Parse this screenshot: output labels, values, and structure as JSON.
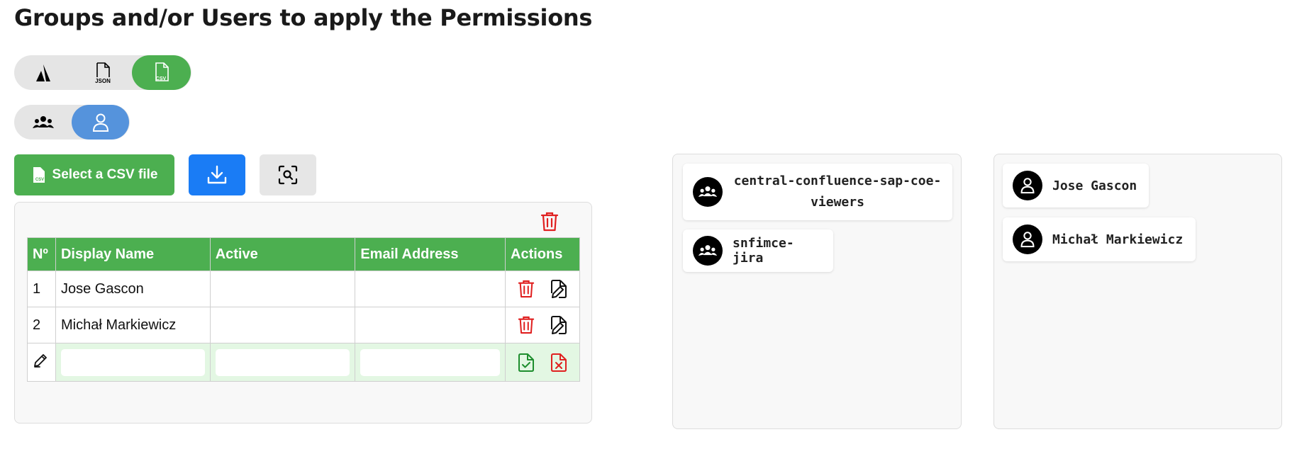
{
  "page_title": "Groups and/or Users to apply the Permissions",
  "source_toggle": {
    "options": [
      {
        "icon": "atlassian-icon",
        "label": ""
      },
      {
        "icon": "json-file-icon",
        "label": "JSON"
      },
      {
        "icon": "csv-file-icon",
        "label": "CSV"
      }
    ],
    "selected": "CSV",
    "active_color": "#4caf50"
  },
  "type_toggle": {
    "options": [
      {
        "icon": "group-icon"
      },
      {
        "icon": "user-icon"
      }
    ],
    "selected": "user",
    "active_color": "#5593dc"
  },
  "toolbar": {
    "select_csv_label": "Select a CSV file",
    "csv_badge": "CSV",
    "download_icon": "download-icon",
    "scan_icon": "scan-search-icon"
  },
  "table": {
    "headers": [
      "Nº",
      "Display Name",
      "Active",
      "Email Address",
      "Actions"
    ],
    "rows": [
      {
        "n": "1",
        "display_name": "Jose Gascon",
        "active": "",
        "email": ""
      },
      {
        "n": "2",
        "display_name": "Michał Markiewicz",
        "active": "",
        "email": ""
      }
    ],
    "edit_row": {
      "display_name": "",
      "active": "",
      "email": ""
    }
  },
  "groups": [
    {
      "name": "central-confluence-sap-coe-viewers"
    },
    {
      "name": "snfimce-jira"
    }
  ],
  "users": [
    {
      "name": "Jose Gascon"
    },
    {
      "name": "Michał Markiewicz"
    }
  ],
  "colors": {
    "green": "#4caf50",
    "blue": "#1a7cf5",
    "danger": "#e02020",
    "success": "#1e8e2e"
  }
}
